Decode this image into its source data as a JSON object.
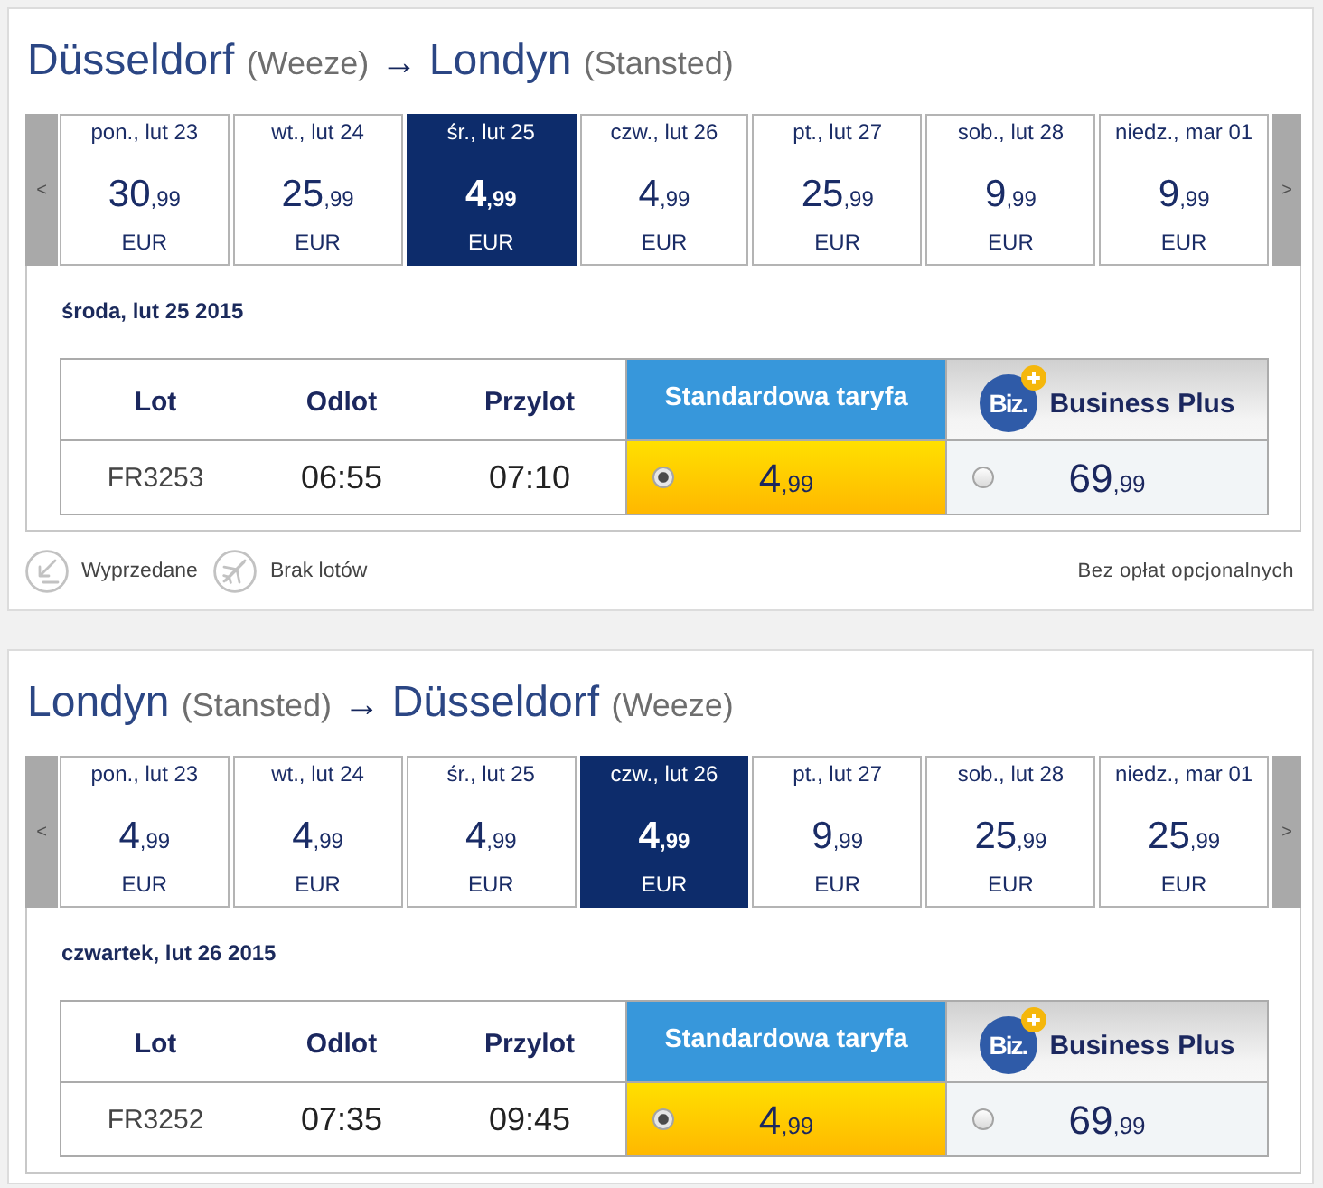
{
  "journeys": [
    {
      "title": {
        "origin": "Düsseldorf",
        "origin_airport": "(Weeze)",
        "arrow": "→",
        "destination": "Londyn",
        "destination_airport": "(Stansted)"
      },
      "prev_button": "<",
      "next_button": ">",
      "dates": [
        {
          "day": "pon., lut 23",
          "price": "30",
          "cents": ",99",
          "currency": "EUR",
          "selected": false
        },
        {
          "day": "wt., lut 24",
          "price": "25",
          "cents": ",99",
          "currency": "EUR",
          "selected": false
        },
        {
          "day": "śr., lut 25",
          "price": "4",
          "cents": ",99",
          "currency": "EUR",
          "selected": true
        },
        {
          "day": "czw., lut 26",
          "price": "4",
          "cents": ",99",
          "currency": "EUR",
          "selected": false
        },
        {
          "day": "pt., lut 27",
          "price": "25",
          "cents": ",99",
          "currency": "EUR",
          "selected": false
        },
        {
          "day": "sob., lut 28",
          "price": "9",
          "cents": ",99",
          "currency": "EUR",
          "selected": false
        },
        {
          "day": "niedz., mar 01",
          "price": "9",
          "cents": ",99",
          "currency": "EUR",
          "selected": false
        }
      ],
      "selected_date": "środa, lut 25 2015",
      "table": {
        "columns": [
          "Lot",
          "Odlot",
          "Przylot"
        ],
        "fares": [
          {
            "kind": "standard",
            "label": "Standardowa taryfa"
          },
          {
            "kind": "business",
            "logo": "Biz.",
            "label": "Business Plus"
          }
        ],
        "rows": [
          {
            "flight": "FR3253",
            "departure": "06:55",
            "arrival": "07:10",
            "prices": [
              {
                "price": "4",
                "cents": ",99",
                "selected": true
              },
              {
                "price": "69",
                "cents": ",99",
                "selected": false
              }
            ]
          }
        ]
      },
      "legend": [
        {
          "kind": "sold_out",
          "label": "Wyprzedane"
        },
        {
          "kind": "no_flights",
          "label": "Brak lotów"
        }
      ],
      "note": "Bez opłat opcjonalnych"
    },
    {
      "title": {
        "origin": "Londyn",
        "origin_airport": "(Stansted)",
        "arrow": "→",
        "destination": "Düsseldorf",
        "destination_airport": "(Weeze)"
      },
      "prev_button": "<",
      "next_button": ">",
      "dates": [
        {
          "day": "pon., lut 23",
          "price": "4",
          "cents": ",99",
          "currency": "EUR",
          "selected": false
        },
        {
          "day": "wt., lut 24",
          "price": "4",
          "cents": ",99",
          "currency": "EUR",
          "selected": false
        },
        {
          "day": "śr., lut 25",
          "price": "4",
          "cents": ",99",
          "currency": "EUR",
          "selected": false
        },
        {
          "day": "czw., lut 26",
          "price": "4",
          "cents": ",99",
          "currency": "EUR",
          "selected": true
        },
        {
          "day": "pt., lut 27",
          "price": "9",
          "cents": ",99",
          "currency": "EUR",
          "selected": false
        },
        {
          "day": "sob., lut 28",
          "price": "25",
          "cents": ",99",
          "currency": "EUR",
          "selected": false
        },
        {
          "day": "niedz., mar 01",
          "price": "25",
          "cents": ",99",
          "currency": "EUR",
          "selected": false
        }
      ],
      "selected_date": "czwartek, lut 26 2015",
      "table": {
        "columns": [
          "Lot",
          "Odlot",
          "Przylot"
        ],
        "fares": [
          {
            "kind": "standard",
            "label": "Standardowa taryfa"
          },
          {
            "kind": "business",
            "logo": "Biz.",
            "label": "Business Plus"
          }
        ],
        "rows": [
          {
            "flight": "FR3252",
            "departure": "07:35",
            "arrival": "09:45",
            "prices": [
              {
                "price": "4",
                "cents": ",99",
                "selected": true
              },
              {
                "price": "69",
                "cents": ",99",
                "selected": false
              }
            ]
          }
        ]
      }
    }
  ]
}
